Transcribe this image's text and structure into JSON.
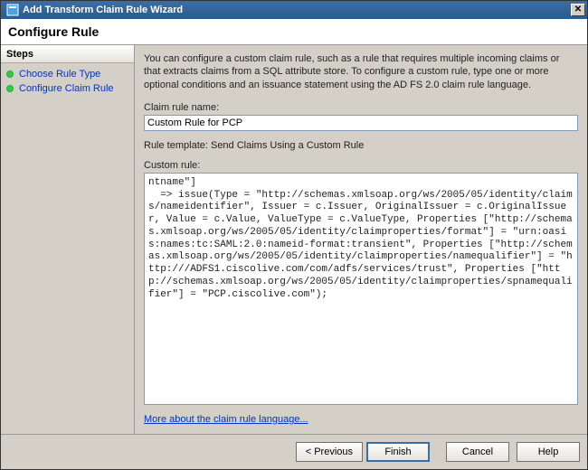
{
  "window": {
    "title": "Add Transform Claim Rule Wizard"
  },
  "header": {
    "title": "Configure Rule"
  },
  "steps": {
    "header": "Steps",
    "items": [
      {
        "label": "Choose Rule Type"
      },
      {
        "label": "Configure Claim Rule"
      }
    ]
  },
  "content": {
    "intro": "You can configure a custom claim rule, such as a rule that requires multiple incoming claims or that extracts claims from a SQL attribute store. To configure a custom rule, type one or more optional conditions and an issuance statement using the AD FS 2.0 claim rule language.",
    "claim_rule_name_label": "Claim rule name:",
    "claim_rule_name_value": "Custom Rule for PCP",
    "rule_template_line": "Rule template: Send Claims Using a Custom Rule",
    "custom_rule_label": "Custom rule:",
    "custom_rule_text": "ntname\"]\n  => issue(Type = \"http://schemas.xmlsoap.org/ws/2005/05/identity/claims/nameidentifier\", Issuer = c.Issuer, OriginalIssuer = c.OriginalIssuer, Value = c.Value, ValueType = c.ValueType, Properties [\"http://schemas.xmlsoap.org/ws/2005/05/identity/claimproperties/format\"] = \"urn:oasis:names:tc:SAML:2.0:nameid-format:transient\", Properties [\"http://schemas.xmlsoap.org/ws/2005/05/identity/claimproperties/namequalifier\"] = \"http:///ADFS1.ciscolive.com/com/adfs/services/trust\", Properties [\"http://schemas.xmlsoap.org/ws/2005/05/identity/claimproperties/spnamequalifier\"] = \"PCP.ciscolive.com\");",
    "more_link": "More about the claim rule language..."
  },
  "buttons": {
    "previous": "< Previous",
    "finish": "Finish",
    "cancel": "Cancel",
    "help": "Help"
  }
}
